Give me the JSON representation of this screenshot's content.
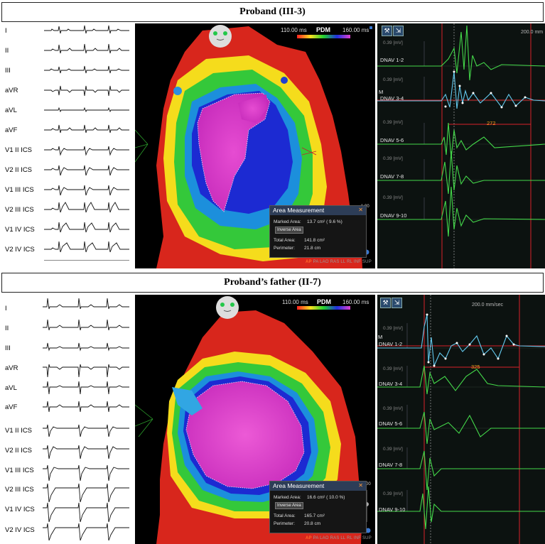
{
  "panels": [
    {
      "title": "Proband (III-3)",
      "leads": [
        "I",
        "II",
        "III",
        "aVR",
        "aVL",
        "aVF",
        "V1 II ICS",
        "V2 II ICS",
        "V1 III ICS",
        "V2 III ICS",
        "V1 IV ICS",
        "V2 IV ICS"
      ],
      "map": {
        "colorbar_min": "110.00 ms",
        "colorbar_title": "PDM",
        "colorbar_max": "160.00 ms",
        "area_measurement": {
          "title": "Area Measurement",
          "marked_area_label": "Marked Area:",
          "marked_area_value": "13.7  cm²  (   9.6  %)",
          "inverse_area_button": "Inverse Area",
          "total_area_label": "Total Area:",
          "total_area_value": "141.8 cm²",
          "perimeter_label": "Perimeter:",
          "perimeter_value": "21.8  cm"
        },
        "slider_top_label": "1.00",
        "view_tab_active": "AP",
        "view_tabs_rest": "PA  LAO  RAS  LL  RL  INF  SUP"
      },
      "egm": {
        "speed_label": "200.0 mm",
        "interval_value": "272",
        "channels": [
          {
            "name": "DNAV 1-2",
            "scale": "0.39  [mV]"
          },
          {
            "name": "DNAV 3-4",
            "scale": "0.39  [mV]"
          },
          {
            "name": "DNAV 5-6",
            "scale": "0.39  [mV]"
          },
          {
            "name": "DNAV 7-8",
            "scale": "0.39  [mV]"
          },
          {
            "name": "DNAV 9-10",
            "scale": "0.39  [mV]"
          }
        ],
        "marker_label": "M"
      }
    },
    {
      "title": "Proband’s father (II-7)",
      "leads": [
        "I",
        "II",
        "III",
        "aVR",
        "aVL",
        "aVF",
        "V1 II ICS",
        "V2 II ICS",
        "V1 III ICS",
        "V2 III ICS",
        "V1 IV ICS",
        "V2 IV ICS"
      ],
      "map": {
        "colorbar_min": "110.00 ms",
        "colorbar_title": "PDM",
        "colorbar_max": "160.00 ms",
        "area_measurement": {
          "title": "Area Measurement",
          "marked_area_label": "Marked Area:",
          "marked_area_value": "16.6  cm²  (  10.0  %)",
          "inverse_area_button": "Inverse Area",
          "total_area_label": "Total Area:",
          "total_area_value": "165.7 cm²",
          "perimeter_label": "Perimeter:",
          "perimeter_value": "20.8  cm"
        },
        "slider_top_label": "1.00",
        "view_tab_active": "AP",
        "view_tabs_rest": "PA  LAO  RAS  LL  RL  INF  SUP"
      },
      "egm": {
        "speed_label": "200.0 mm/sec",
        "interval_value": "325",
        "channels": [
          {
            "name": "DNAV 1-2",
            "scale": "0.39  [mV]"
          },
          {
            "name": "DNAV 3-4",
            "scale": "0.39  [mV]"
          },
          {
            "name": "DNAV 5-6",
            "scale": "0.39  [mV]"
          },
          {
            "name": "DNAV 7-8",
            "scale": "0.39  [mV]"
          },
          {
            "name": "DNAV 9-10",
            "scale": "0.39  [mV]"
          }
        ],
        "marker_label": "M"
      }
    }
  ],
  "colors": {
    "map_red": "#e0281c",
    "map_yellow": "#f2e21a",
    "map_green": "#2fcf3a",
    "map_blue": "#1c2fd6",
    "map_magenta": "#dd36c6",
    "egm_green": "#44d84a",
    "egm_cyan": "#63c9ee",
    "egm_red_line": "#d8222a",
    "interval_orange": "#f0a020"
  }
}
